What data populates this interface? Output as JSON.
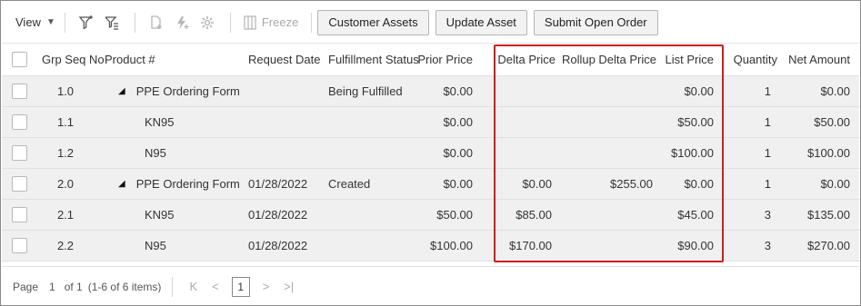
{
  "toolbar": {
    "view_label": "View",
    "freeze_label": "Freeze",
    "buttons": [
      "Customer Assets",
      "Update Asset",
      "Submit Open Order"
    ]
  },
  "columns": {
    "grp_seq_no": "Grp Seq No",
    "product": "Product #",
    "request_date": "Request Date",
    "fulfillment_status": "Fulfillment Status",
    "prior_price": "Prior Price",
    "delta_price": "Delta Price",
    "rollup_delta_price": "Rollup Delta Price",
    "list_price": "List Price",
    "quantity": "Quantity",
    "net_amount": "Net Amount"
  },
  "rows": [
    {
      "seq": "1.0",
      "product": "PPE Ordering Form",
      "expandable": true,
      "request_date": "",
      "status": "Being Fulfilled",
      "prior_price": "$0.00",
      "delta_price": "",
      "rollup_delta_price": "",
      "list_price": "$0.00",
      "quantity": "1",
      "net_amount": "$0.00"
    },
    {
      "seq": "1.1",
      "product": "KN95",
      "expandable": false,
      "request_date": "",
      "status": "",
      "prior_price": "$0.00",
      "delta_price": "",
      "rollup_delta_price": "",
      "list_price": "$50.00",
      "quantity": "1",
      "net_amount": "$50.00"
    },
    {
      "seq": "1.2",
      "product": "N95",
      "expandable": false,
      "request_date": "",
      "status": "",
      "prior_price": "$0.00",
      "delta_price": "",
      "rollup_delta_price": "",
      "list_price": "$100.00",
      "quantity": "1",
      "net_amount": "$100.00"
    },
    {
      "seq": "2.0",
      "product": "PPE Ordering Form",
      "expandable": true,
      "request_date": "01/28/2022",
      "status": "Created",
      "prior_price": "$0.00",
      "delta_price": "$0.00",
      "rollup_delta_price": "$255.00",
      "list_price": "$0.00",
      "quantity": "1",
      "net_amount": "$0.00"
    },
    {
      "seq": "2.1",
      "product": "KN95",
      "expandable": false,
      "request_date": "01/28/2022",
      "status": "",
      "prior_price": "$50.00",
      "delta_price": "$85.00",
      "rollup_delta_price": "",
      "list_price": "$45.00",
      "quantity": "3",
      "net_amount": "$135.00"
    },
    {
      "seq": "2.2",
      "product": "N95",
      "expandable": false,
      "request_date": "01/28/2022",
      "status": "",
      "prior_price": "$100.00",
      "delta_price": "$170.00",
      "rollup_delta_price": "",
      "list_price": "$90.00",
      "quantity": "3",
      "net_amount": "$270.00"
    }
  ],
  "pager": {
    "page_label": "Page",
    "page_number": "1",
    "of_label": "of 1",
    "items_label": "(1-6 of 6 items)",
    "current_page": "1",
    "first_icon": "K",
    "prev_icon": "<",
    "next_icon": ">",
    "last_icon": ">|"
  },
  "colors": {
    "highlight": "#cc1f1f",
    "row_bg": "#f0f0f0"
  }
}
